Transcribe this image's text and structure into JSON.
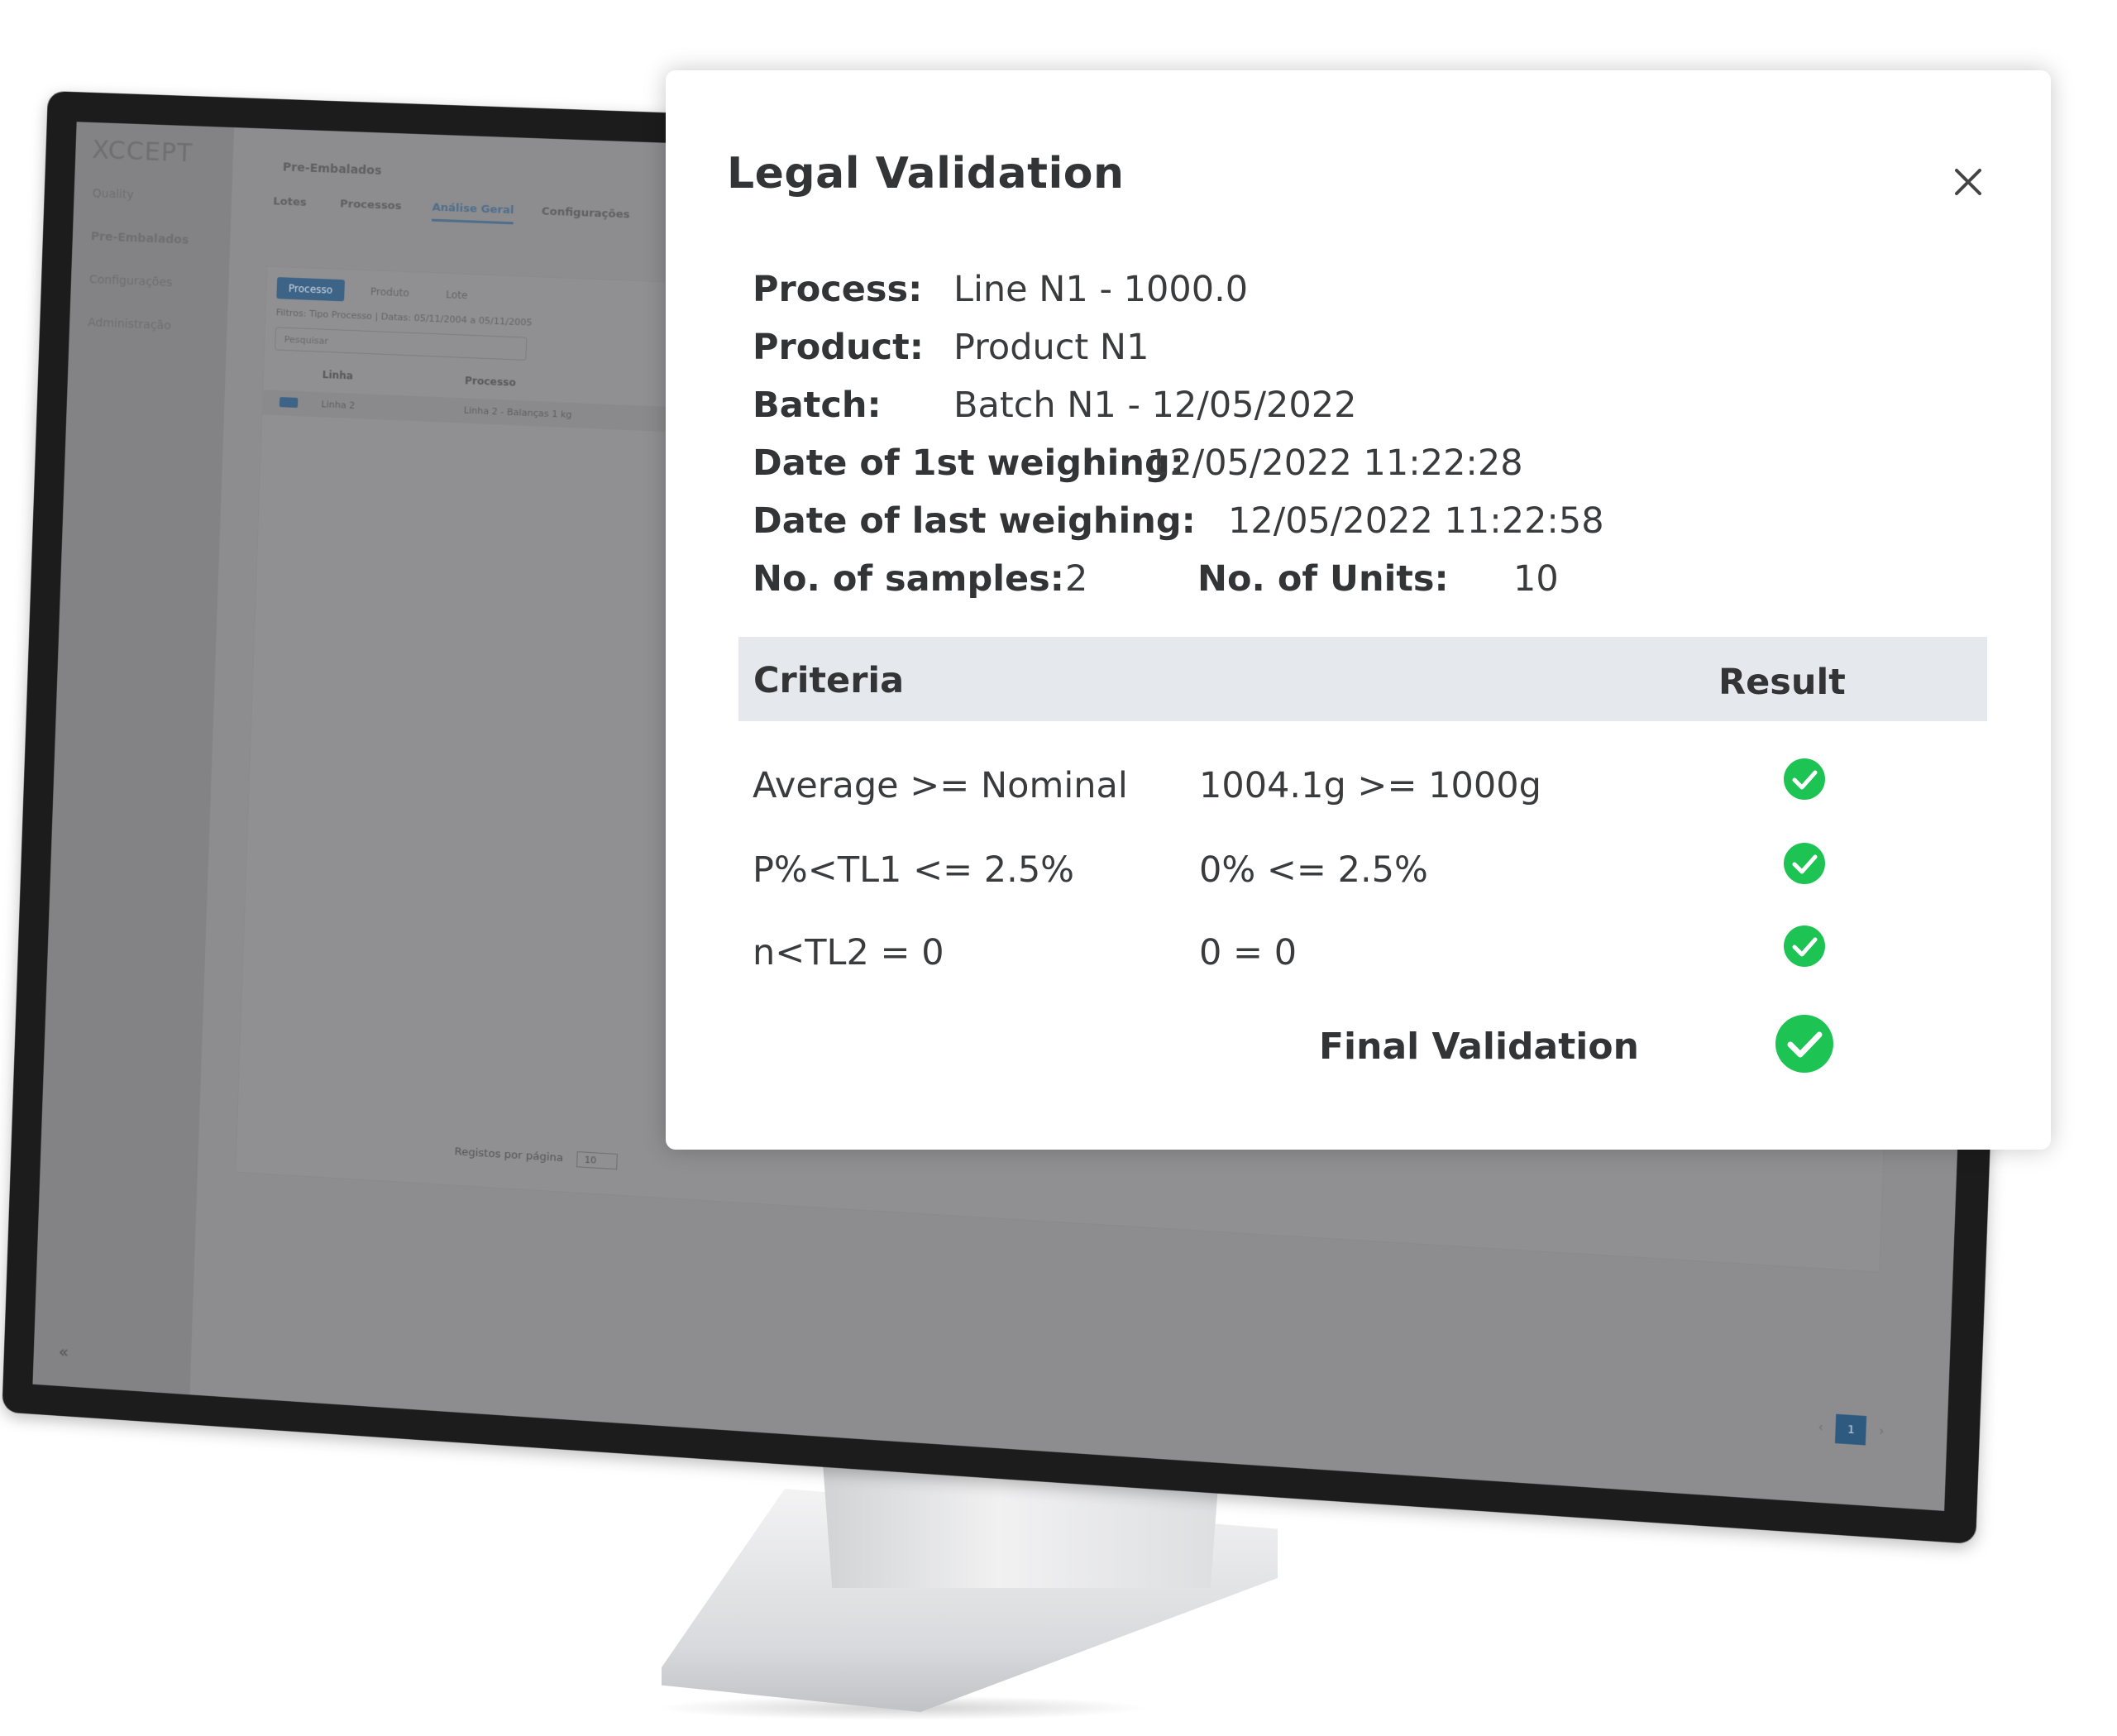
{
  "background_app": {
    "logo": "XCCEPT",
    "header_title": "Pre-Embalados",
    "sidebar_items": [
      "Quality",
      "Pre-Embalados",
      "Configurações",
      "Administração"
    ],
    "top_nav": [
      "Lotes",
      "Processos",
      "Análise Geral",
      "Configurações"
    ],
    "chips": [
      "Processo",
      "Produto",
      "Lote"
    ],
    "filter_text": "Filtros: Tipo Processo | Datas: 05/11/2004 a 05/11/2005",
    "search_placeholder": "Pesquisar",
    "columns": [
      "Linha",
      "Processo"
    ],
    "row": [
      "Linha 2",
      "Linha 2 - Balanças 1 kg"
    ],
    "per_page_label": "Registos por página",
    "per_page_value": "10",
    "current_page": "1",
    "collapse_label": "«"
  },
  "dialog": {
    "title": "Legal Validation",
    "info": {
      "process_label": "Process:",
      "process_value": "Line N1 - 1000.0",
      "product_label": "Product:",
      "product_value": "Product N1",
      "batch_label": "Batch:",
      "batch_value": "Batch N1 - 12/05/2022",
      "first_weighing_label": "Date of 1st weighing:",
      "first_weighing_value": "12/05/2022 11:22:28",
      "last_weighing_label": "Date of last weighing:",
      "last_weighing_value": "12/05/2022 11:22:58",
      "samples_label": "No. of samples:",
      "samples_value": "2",
      "units_label": "No. of Units:",
      "units_value": "10"
    },
    "table": {
      "header_criteria": "Criteria",
      "header_result": "Result",
      "rows": [
        {
          "criteria": "Average >= Nominal",
          "value": "1004.1g  >= 1000g",
          "result": "pass"
        },
        {
          "criteria": "P%<TL1 <= 2.5%",
          "value": "0%  <= 2.5%",
          "result": "pass"
        },
        {
          "criteria": "n<TL2 = 0",
          "value": "0 = 0",
          "result": "pass"
        }
      ]
    },
    "final_label": "Final Validation",
    "final_result": "pass",
    "icons": {
      "close": "close-icon",
      "check": "check-circle-icon"
    },
    "colors": {
      "check_green": "#1ec453",
      "header_bg": "#e5e8ed",
      "text": "#333436"
    }
  }
}
